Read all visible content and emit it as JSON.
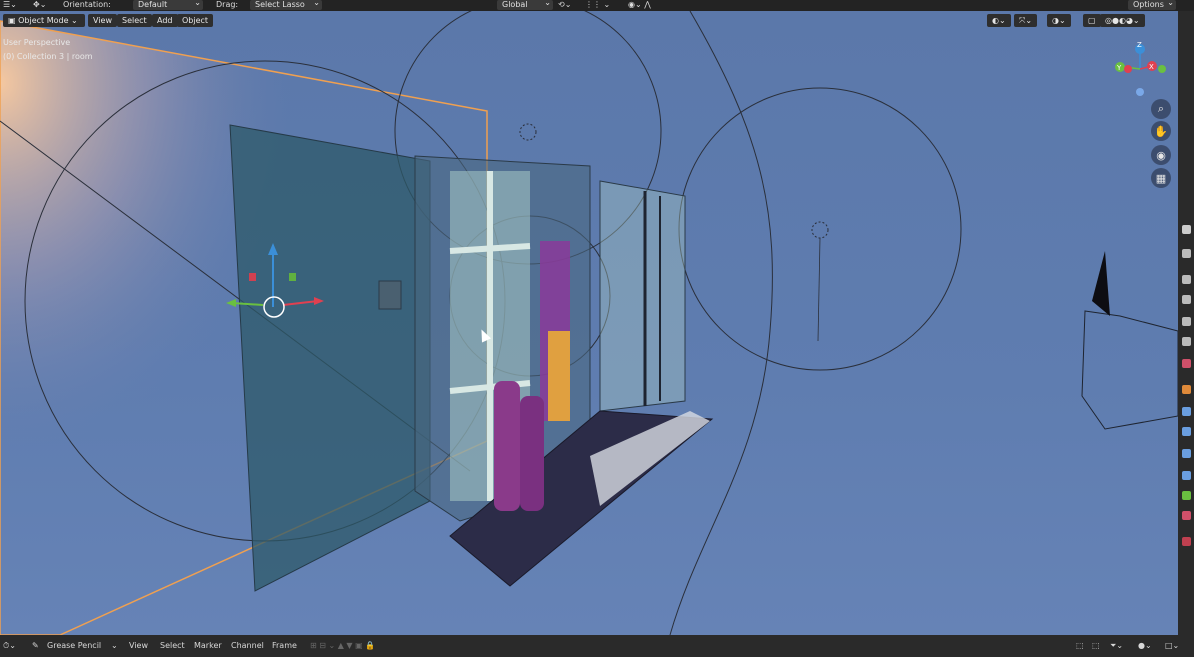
{
  "topbar": {
    "orientation_label": "Orientation:",
    "orientation_value": "Default",
    "transform_label": "Global",
    "drag_label": "Drag:",
    "drag_value": "Select Lasso",
    "options_label": "Options"
  },
  "viewport_header": {
    "mode": "Object Mode",
    "menu": [
      "View",
      "Select",
      "Add",
      "Object"
    ]
  },
  "viewport_overlay": {
    "view_name": "User Perspective",
    "collection": "(0) Collection 3 | room"
  },
  "gizmo": {
    "z_label": "Z",
    "x_label": "X",
    "y_label": "Y"
  },
  "bottombar": {
    "editor": "Grease Pencil",
    "menu": [
      "View",
      "Select",
      "Marker",
      "Channel",
      "Frame"
    ]
  },
  "colors": {
    "viewport_bg": "#5f7db0",
    "selection_orange": "#f0a050",
    "header_bg": "#232323"
  }
}
